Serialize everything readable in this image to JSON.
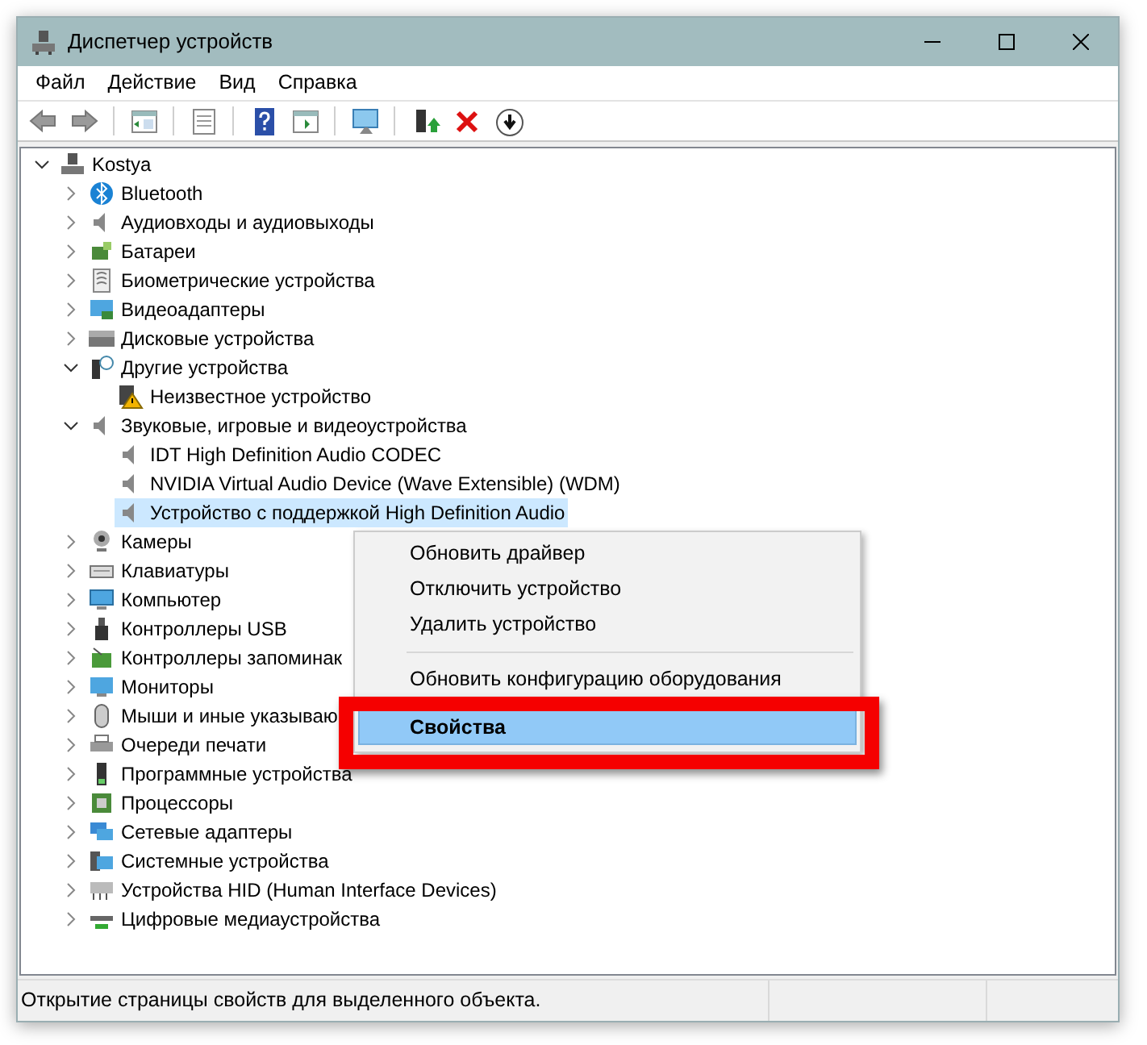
{
  "window": {
    "title": "Диспетчер устройств"
  },
  "menu": [
    "Файл",
    "Действие",
    "Вид",
    "Справка"
  ],
  "tree": [
    {
      "label": "Kostya",
      "expanded": true,
      "selected": false,
      "children": [
        {
          "label": "Bluetooth",
          "expanded": false,
          "selected": false
        },
        {
          "label": "Аудиовходы и аудиовыходы",
          "expanded": false,
          "selected": false
        },
        {
          "label": "Батареи",
          "expanded": false,
          "selected": false
        },
        {
          "label": "Биометрические устройства",
          "expanded": false,
          "selected": false
        },
        {
          "label": "Видеоадаптеры",
          "expanded": false,
          "selected": false
        },
        {
          "label": "Дисковые устройства",
          "expanded": false,
          "selected": false
        },
        {
          "label": "Другие устройства",
          "expanded": true,
          "selected": false,
          "children": [
            {
              "label": "Неизвестное устройство",
              "selected": false
            }
          ]
        },
        {
          "label": "Звуковые, игровые и видеоустройства",
          "expanded": true,
          "selected": false,
          "children": [
            {
              "label": "IDT High Definition Audio CODEC",
              "selected": false
            },
            {
              "label": "NVIDIA Virtual Audio Device (Wave Extensible) (WDM)",
              "selected": false
            },
            {
              "label": "Устройство с поддержкой High Definition Audio",
              "selected": true
            }
          ]
        },
        {
          "label": "Камеры",
          "expanded": false,
          "selected": false
        },
        {
          "label": "Клавиатуры",
          "expanded": false,
          "selected": false
        },
        {
          "label": "Компьютер",
          "expanded": false,
          "selected": false
        },
        {
          "label": "Контроллеры USB",
          "expanded": false,
          "selected": false
        },
        {
          "label": "Контроллеры запоминак",
          "expanded": false,
          "selected": false
        },
        {
          "label": "Мониторы",
          "expanded": false,
          "selected": false
        },
        {
          "label": "Мыши и иные указываю",
          "expanded": false,
          "selected": false
        },
        {
          "label": "Очереди печати",
          "expanded": false,
          "selected": false
        },
        {
          "label": "Программные устройства",
          "expanded": false,
          "selected": false
        },
        {
          "label": "Процессоры",
          "expanded": false,
          "selected": false
        },
        {
          "label": "Сетевые адаптеры",
          "expanded": false,
          "selected": false
        },
        {
          "label": "Системные устройства",
          "expanded": false,
          "selected": false
        },
        {
          "label": "Устройства HID (Human Interface Devices)",
          "expanded": false,
          "selected": false
        },
        {
          "label": "Цифровые медиаустройства",
          "expanded": false,
          "selected": false
        }
      ]
    }
  ],
  "context_menu": {
    "items": [
      {
        "label": "Обновить драйвер",
        "selected": false,
        "separator_before": false,
        "highlighted": false
      },
      {
        "label": "Отключить устройство",
        "selected": false,
        "separator_before": false,
        "highlighted": false
      },
      {
        "label": "Удалить устройство",
        "selected": false,
        "separator_before": false,
        "highlighted": false
      },
      {
        "label": "Обновить конфигурацию оборудования",
        "selected": false,
        "separator_before": true,
        "highlighted": false
      },
      {
        "label": "Свойства",
        "selected": true,
        "separator_before": false,
        "highlighted": true
      }
    ]
  },
  "status_bar": {
    "text": "Открытие страницы свойств для выделенного объекта."
  }
}
